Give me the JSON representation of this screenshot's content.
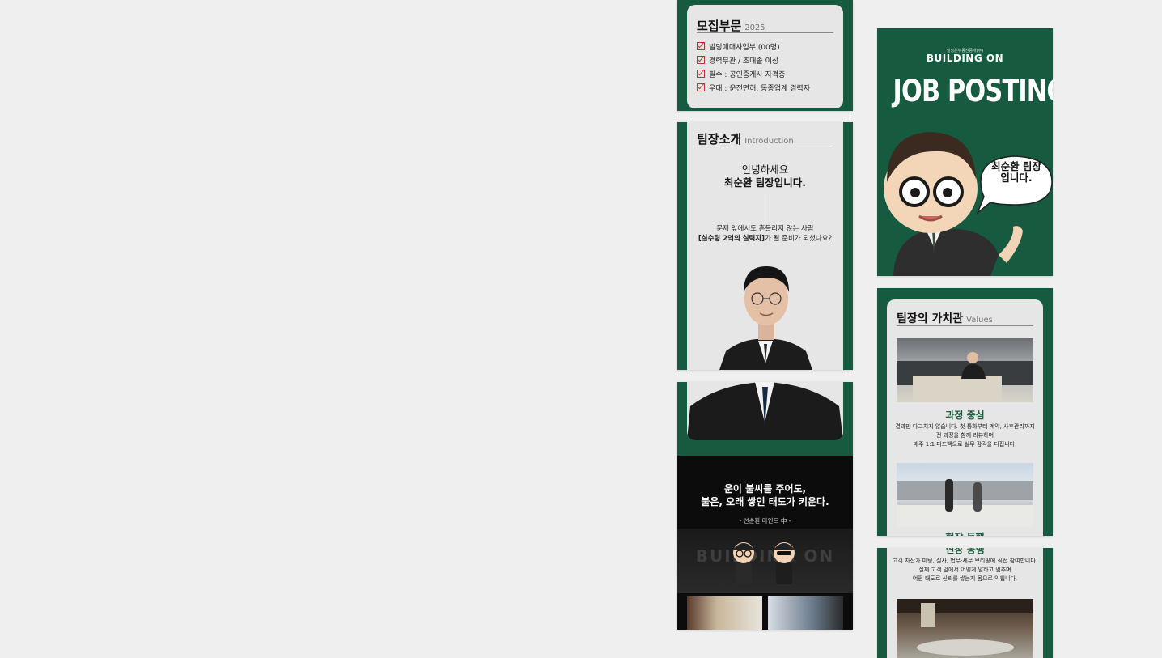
{
  "recruit": {
    "title": "모집부문",
    "year": "2025",
    "items": [
      "빌딩매매사업부 (00명)",
      "경력무관 / 초대졸 이상",
      "필수 : 공인중개사 자격증",
      "우대 : 운전면허, 동종업계 경력자"
    ]
  },
  "intro": {
    "title": "팀장소개",
    "subtitle": "Introduction",
    "greeting1": "안녕하세요",
    "greeting2": "최순환 팀장입니다.",
    "line1": "문제 앞에서도 흔들리지 않는 사람",
    "line2_bold": "[실수령 2억의 실력자]",
    "line2_rest": "가 될 준비가 되셨나요?"
  },
  "quote": {
    "line1": "운이 불씨를 주어도,",
    "line2": "불은, 오래 쌓인 태도가 키운다.",
    "source": "- 선순환 마인드 中 -",
    "stage_logo": "BUILDING ON"
  },
  "cover": {
    "company": "빌딩온부동산중개(주)",
    "brand": "BUILDING ON",
    "title": "JOB POSTING",
    "bubble1": "최순환 팀장",
    "bubble2": "입니다."
  },
  "values": {
    "title": "팀장의 가치관",
    "subtitle": "Values",
    "h1": "과정 중심",
    "p1": [
      "결과만 다그치지 않습니다. 첫 통화부터 계약, 사후관리까지",
      "전 과정을 함께 리뷰하며",
      "매주 1:1 피드백으로 실무 감각을 다집니다."
    ],
    "h2": "현장 동행",
    "p2": [
      "고객 자산가 미팅, 실사, 법무·세무 브리핑에 직접 참여합니다.",
      "실제 고객 앞에서 어떻게 말하고 멈추며",
      "어떤 태도로 신뢰를 쌓는지 몸으로 익힙니다."
    ]
  },
  "colors": {
    "brand_green": "#165a3f",
    "card_gray": "#e6e6e6",
    "check_red": "#b33333"
  }
}
